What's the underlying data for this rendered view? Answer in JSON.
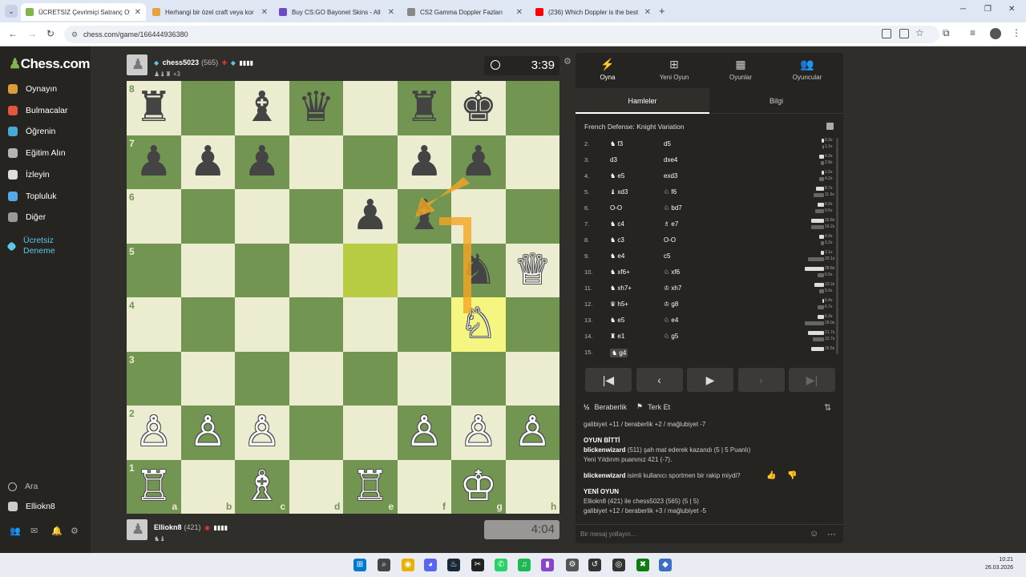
{
  "browser": {
    "tabs": [
      {
        "label": "ÜCRETSİZ Çevrimiçi Satranç Oy",
        "active": true,
        "color": "#81b64c"
      },
      {
        "label": "Herhangi bir özel craft veya kor",
        "active": false,
        "color": "#e6a23c"
      },
      {
        "label": "Buy CS:GO Bayonet Skins - All ",
        "active": false,
        "color": "#6d4cc2"
      },
      {
        "label": "CS2 Gamma Doppler Fazları",
        "active": false,
        "color": "#888888"
      },
      {
        "label": "(236) Which Doppler is the best",
        "active": false,
        "color": "#ff0000"
      }
    ],
    "url": "chess.com/game/166444936380",
    "new_tab": "+",
    "dropdown": "⌄"
  },
  "sidebar": {
    "logo_prefix": "♟",
    "logo": "Chess.com",
    "items": [
      {
        "label": "Oynayın",
        "color": "#d99e3a"
      },
      {
        "label": "Bulmacalar",
        "color": "#e2553e"
      },
      {
        "label": "Öğrenin",
        "color": "#48a8d8"
      },
      {
        "label": "Eğitim Alın",
        "color": "#b4b4b4"
      },
      {
        "label": "İzleyin",
        "color": "#dddddd"
      },
      {
        "label": "Topluluk",
        "color": "#58a8e8"
      },
      {
        "label": "Diğer",
        "color": "#999999"
      }
    ],
    "trial_line1": "Ücretsiz",
    "trial_line2": "Deneme",
    "search": "Ara",
    "user": "Elliokn8"
  },
  "game": {
    "top_player": {
      "name": "chess5023",
      "rating": "(565)",
      "sub": "+3"
    },
    "bottom_player": {
      "name": "Elliokn8",
      "rating": "(421)"
    },
    "top_clock": "3:39",
    "bottom_clock": "4:04",
    "ranks": [
      "8",
      "7",
      "6",
      "5",
      "4",
      "3",
      "2",
      "1"
    ],
    "files": [
      "a",
      "b",
      "c",
      "d",
      "e",
      "f",
      "g",
      "h"
    ],
    "pieces": [
      {
        "sq": "a8",
        "p": "♜",
        "c": "b"
      },
      {
        "sq": "c8",
        "p": "♝",
        "c": "b"
      },
      {
        "sq": "d8",
        "p": "♛",
        "c": "b"
      },
      {
        "sq": "f8",
        "p": "♜",
        "c": "b"
      },
      {
        "sq": "g8",
        "p": "♚",
        "c": "b"
      },
      {
        "sq": "a7",
        "p": "♟",
        "c": "b"
      },
      {
        "sq": "b7",
        "p": "♟",
        "c": "b"
      },
      {
        "sq": "c7",
        "p": "♟",
        "c": "b"
      },
      {
        "sq": "f7",
        "p": "♟",
        "c": "b"
      },
      {
        "sq": "g7",
        "p": "♟",
        "c": "b"
      },
      {
        "sq": "e6",
        "p": "♟",
        "c": "b"
      },
      {
        "sq": "f6",
        "p": "♝",
        "c": "b"
      },
      {
        "sq": "g5",
        "p": "♞",
        "c": "b"
      },
      {
        "sq": "h5",
        "p": "♕",
        "c": "w"
      },
      {
        "sq": "g4",
        "p": "♘",
        "c": "w"
      },
      {
        "sq": "a2",
        "p": "♙",
        "c": "w"
      },
      {
        "sq": "b2",
        "p": "♙",
        "c": "w"
      },
      {
        "sq": "c2",
        "p": "♙",
        "c": "w"
      },
      {
        "sq": "f2",
        "p": "♙",
        "c": "w"
      },
      {
        "sq": "g2",
        "p": "♙",
        "c": "w"
      },
      {
        "sq": "h2",
        "p": "♙",
        "c": "w"
      },
      {
        "sq": "a1",
        "p": "♖",
        "c": "w"
      },
      {
        "sq": "c1",
        "p": "♗",
        "c": "w"
      },
      {
        "sq": "e1",
        "p": "♖",
        "c": "w"
      },
      {
        "sq": "g1",
        "p": "♔",
        "c": "w"
      }
    ],
    "highlights": [
      "e5",
      "g4"
    ]
  },
  "panel": {
    "tabs": [
      {
        "label": "Oyna",
        "icon": "⚡"
      },
      {
        "label": "Yeni Oyun",
        "icon": "⊞"
      },
      {
        "label": "Oyunlar",
        "icon": "▦"
      },
      {
        "label": "Oyuncular",
        "icon": "👥"
      }
    ],
    "subtabs": [
      "Hamleler",
      "Bilgi"
    ],
    "opening": "French Defense: Knight Variation",
    "moves": [
      {
        "n": "2.",
        "w": "♞ f3",
        "b": "d5",
        "tw": "0.3s",
        "tb": "1.1s",
        "ww": 3,
        "wb": 2
      },
      {
        "n": "3.",
        "w": "d3",
        "b": "dxe4",
        "tw": "4.3s",
        "tb": "2.8s",
        "ww": 6,
        "wb": 4
      },
      {
        "n": "4.",
        "w": "♞ e5",
        "b": "exd3",
        "tw": "1.5s",
        "tb": "4.2s",
        "ww": 3,
        "wb": 6
      },
      {
        "n": "5.",
        "w": "♝ xd3",
        "b": "♘ f6",
        "tw": "8.7s",
        "tb": "11.5s",
        "ww": 10,
        "wb": 13
      },
      {
        "n": "6.",
        "w": "O-O",
        "b": "♘ bd7",
        "tw": "6.0s",
        "tb": "9.5s",
        "ww": 8,
        "wb": 11
      },
      {
        "n": "7.",
        "w": "♞ c4",
        "b": "♗ e7",
        "tw": "16.8s",
        "tb": "16.2s",
        "ww": 16,
        "wb": 16
      },
      {
        "n": "8.",
        "w": "♞ c3",
        "b": "O-O",
        "tw": "4.9s",
        "tb": "3.2s",
        "ww": 6,
        "wb": 4
      },
      {
        "n": "9.",
        "w": "♞ e4",
        "b": "c5",
        "tw": "3.1s",
        "tb": "20.1s",
        "ww": 4,
        "wb": 20
      },
      {
        "n": "10.",
        "w": "♞ xf6+",
        "b": "♘ xf6",
        "tw": "28.8s",
        "tb": "6.5s",
        "ww": 24,
        "wb": 8
      },
      {
        "n": "11.",
        "w": "♞ xh7+",
        "b": "♔ xh7",
        "tw": "10.2s",
        "tb": "5.0s",
        "ww": 12,
        "wb": 6
      },
      {
        "n": "12.",
        "w": "♛ h5+",
        "b": "♔ g8",
        "tw": "0.4s",
        "tb": "6.7s",
        "ww": 2,
        "wb": 8
      },
      {
        "n": "13.",
        "w": "♞ e5",
        "b": "♘ e4",
        "tw": "6.3s",
        "tb": "29.0s",
        "ww": 8,
        "wb": 24
      },
      {
        "n": "14.",
        "w": "♜ e1",
        "b": "♘ g5",
        "tw": "21.7s",
        "tb": "12.7s",
        "ww": 20,
        "wb": 14
      },
      {
        "n": "15.",
        "w": "♞ g4",
        "b": "",
        "tw": "16.5s",
        "tb": "",
        "ww": 16,
        "wb": 0
      }
    ],
    "controls": [
      "|◀",
      "‹",
      "▶",
      "›",
      "▶|"
    ],
    "draw": "Beraberlik",
    "resign": "Terk Et",
    "chat": {
      "line1": "galibiyet +11 / beraberlik +2 / mağlubiyet -7",
      "over_title": "OYUN BİTTİ",
      "winner": "blickenwizard",
      "winner_text": " (511) şah mat ederek kazandı (5 | 5 Puanlı)",
      "rating_line": "Yeni Yıldırım puanınız 421 (-7).",
      "sportsman_user": "blickenwizard",
      "sportsman_q": " isimli kullanıcı sportmen bir rakip miydi?",
      "new_title": "YENİ OYUN",
      "new_line": "Elliokn8 (421) ile chess5023 (565) (5 | 5)",
      "new_stats": "galibiyet +12 / beraberlik +3 / mağlubiyet -5"
    },
    "message_placeholder": "Bir mesaj yollayın..."
  },
  "taskbar": {
    "time": "10:21",
    "date": "26.03.2026"
  }
}
